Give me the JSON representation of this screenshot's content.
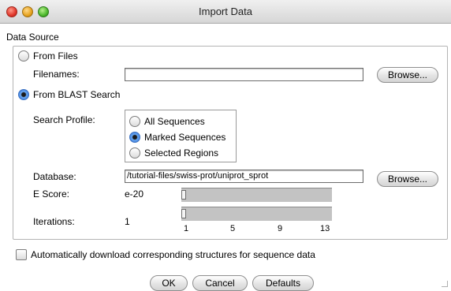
{
  "window": {
    "title": "Import Data"
  },
  "data_source": {
    "label": "Data Source",
    "from_files": {
      "label": "From Files",
      "selected": false,
      "filenames_label": "Filenames:",
      "filenames_value": "",
      "browse_label": "Browse..."
    },
    "from_blast": {
      "label": "From BLAST Search",
      "selected": true,
      "search_profile": {
        "label": "Search Profile:",
        "options": [
          {
            "label": "All Sequences",
            "selected": false
          },
          {
            "label": "Marked Sequences",
            "selected": true
          },
          {
            "label": "Selected Regions",
            "selected": false
          }
        ]
      },
      "database": {
        "label": "Database:",
        "value": "/tutorial-files/swiss-prot/uniprot_sprot",
        "browse_label": "Browse..."
      },
      "escore": {
        "label": "E Score:",
        "value": "e-20",
        "level": 0
      },
      "iterations": {
        "label": "Iterations:",
        "value": "1",
        "level": 0,
        "tick_labels": [
          "1",
          "5",
          "9",
          "13"
        ]
      }
    }
  },
  "auto_download": {
    "label": "Automatically download corresponding structures for sequence data",
    "checked": false
  },
  "buttons": {
    "ok": "OK",
    "cancel": "Cancel",
    "defaults": "Defaults"
  }
}
